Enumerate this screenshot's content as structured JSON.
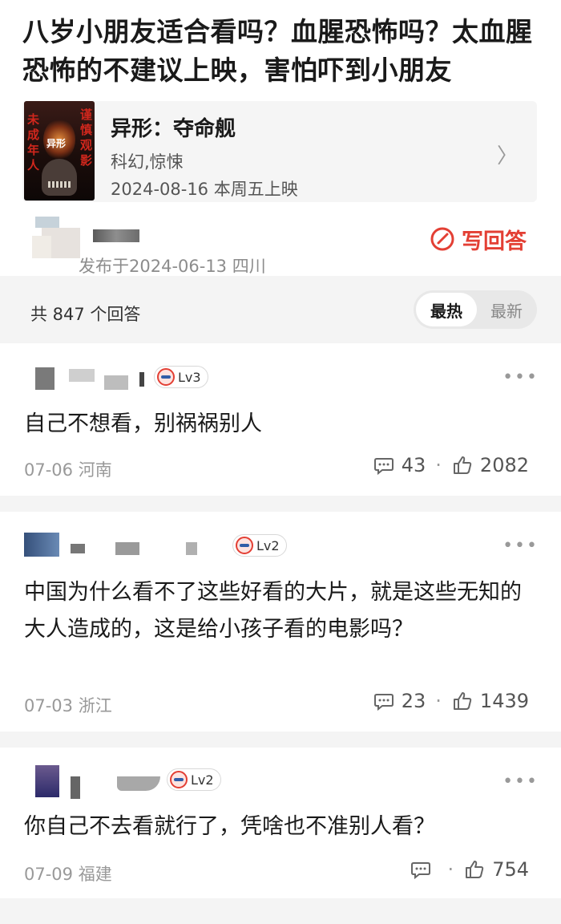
{
  "question": {
    "title": "八岁小朋友适合看吗？血腥恐怖吗？太血腥恐怖的不建议上映，害怕吓到小朋友",
    "asked_meta": "发布于2024-06-13  四川",
    "write_answer_label": "写回答"
  },
  "movie": {
    "name": "异形：夺命舰",
    "genre": "科幻,惊悚",
    "release": "2024-08-16 本周五上映",
    "poster_text_left": "未成年人",
    "poster_text_right": "谨慎观影",
    "poster_logo": "异形"
  },
  "list_header": {
    "count_label": "共 847 个回答",
    "sort_hot": "最热",
    "sort_new": "最新"
  },
  "answers": [
    {
      "level": "Lv3",
      "text": "自己不想看，别祸祸别人",
      "date": "07-06",
      "region": "河南",
      "comments": "43",
      "likes": "2082"
    },
    {
      "level": "Lv2",
      "text": "中国为什么看不了这些好看的大片，就是这些无知的大人造成的，这是给小孩子看的电影吗？",
      "date": "07-03",
      "region": "浙江",
      "comments": "23",
      "likes": "1439"
    },
    {
      "level": "Lv2",
      "text": "你自己不去看就行了，凭啥也不准别人看？",
      "date": "07-09",
      "region": "福建",
      "comments": "",
      "likes": "754"
    }
  ],
  "colors": {
    "accent": "#e33f34",
    "muted": "#999999",
    "band": "#f4f4f4"
  },
  "icons": {
    "write": "edit-circle-icon",
    "chevron": "chevron-right-icon",
    "comment": "comment-bubble-icon",
    "like": "thumbs-up-icon",
    "more": "more-dots-icon"
  }
}
